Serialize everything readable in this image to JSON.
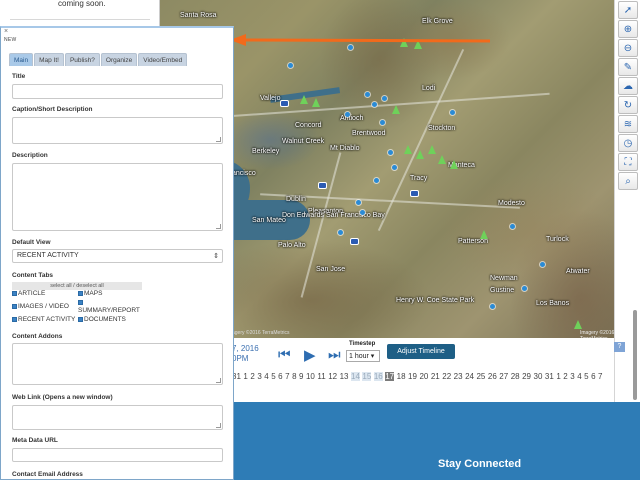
{
  "background_card": {
    "text": "coming soon."
  },
  "map": {
    "cities": [
      "Santa Rosa",
      "Elk Grove",
      "Vallejo",
      "Concord",
      "Antioch",
      "Stockton",
      "Berkeley",
      "Walnut Creek",
      "Mt Diablo",
      "Brentwood",
      "Lodi",
      "ancisco",
      "Manteca",
      "Tracy",
      "Pleasanton",
      "Dublin",
      "San Mateo",
      "Palo Alto",
      "San Jose",
      "Modesto",
      "Turlock",
      "Patterson",
      "Newman",
      "Gustine",
      "Henry W. Coe State Park",
      "Don Edwards San Francisco Bay",
      "Atwater",
      "Los Banos"
    ],
    "attribution": "agery ©2016 TerraMetrics",
    "scale": "Imagery ©2016 TerraMetrics"
  },
  "toolbar": {
    "icons": [
      "pointer-icon",
      "zoom-in-icon",
      "zoom-out-icon",
      "pencil-icon",
      "cloud-upload-icon",
      "refresh-icon",
      "layers-icon",
      "clock-icon",
      "fullscreen-icon",
      "search-icon"
    ]
  },
  "timeline": {
    "date_line1": "7, 2016",
    "date_line2": "0PM",
    "step_label": "Timestep",
    "step_value": "1 hour",
    "adjust_label": "Adjust Timeline",
    "help": "?",
    "days": [
      "31",
      "1",
      "2",
      "3",
      "4",
      "5",
      "6",
      "7",
      "8",
      "9",
      "10",
      "11",
      "12",
      "13",
      "14",
      "15",
      "16",
      "17",
      "18",
      "19",
      "20",
      "21",
      "22",
      "23",
      "24",
      "25",
      "26",
      "27",
      "28",
      "29",
      "30",
      "31",
      "1",
      "2",
      "3",
      "4",
      "5",
      "6",
      "7"
    ],
    "selected_range": [
      "14",
      "15",
      "16"
    ],
    "current_day": "17"
  },
  "footer": {
    "title": "Stay Connected"
  },
  "panel": {
    "close": "×",
    "new_label": "NEW",
    "tabs": [
      {
        "label": "Main",
        "active": true
      },
      {
        "label": "Map It!",
        "active": false
      },
      {
        "label": "Publish?",
        "active": false
      },
      {
        "label": "Organize",
        "active": false
      },
      {
        "label": "Video/Embed",
        "active": false
      }
    ],
    "title_label": "Title",
    "title_value": "",
    "caption_label": "Caption/Short Description",
    "description_label": "Description",
    "default_view_label": "Default View",
    "default_view_value": "RECENT ACTIVITY",
    "content_tabs_label": "Content Tabs",
    "select_all": "select all / deselect all",
    "checkboxes": {
      "article": "ARTICLE",
      "maps": "MAPS",
      "images_video": "IMAGES / VIDEO",
      "summary_report": "SUMMARY/REPORT",
      "recent_activity": "RECENT ACTIVITY",
      "documents": "DOCUMENTS"
    },
    "content_addons_label": "Content Addons",
    "web_link_label": "Web Link (Opens a new window)",
    "meta_data_label": "Meta Data URL",
    "contact_email_label": "Contact Email Address"
  },
  "colors": {
    "accent": "#2e7cb6",
    "arrow": "#f26a1b",
    "adjust_button": "#1e5f86",
    "pin": "#2a8bd6",
    "leaf": "#6fd15a"
  }
}
